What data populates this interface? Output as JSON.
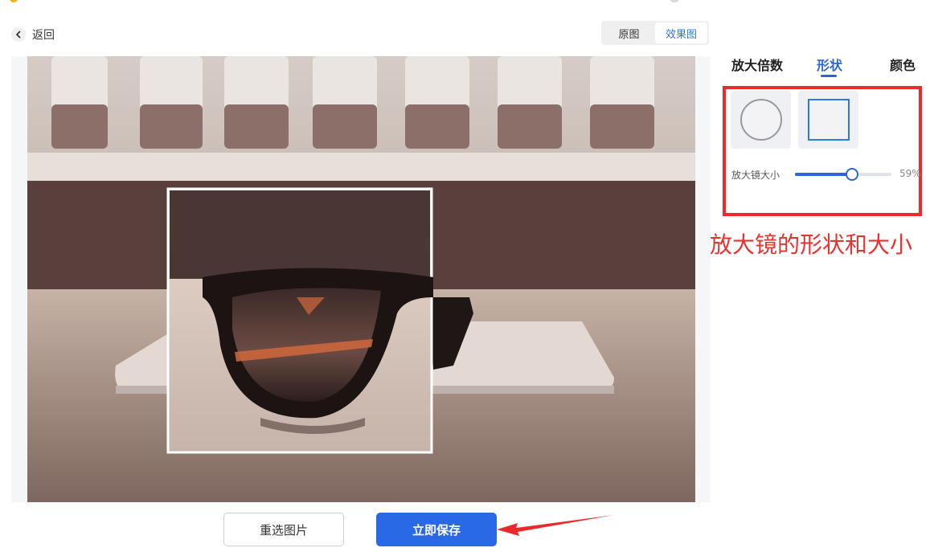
{
  "header": {
    "back_label": "返回",
    "view_toggle": {
      "original_label": "原图",
      "effect_label": "效果图",
      "active": "效果图"
    }
  },
  "panel": {
    "tabs": [
      {
        "label": "放大倍数",
        "active": false
      },
      {
        "label": "形状",
        "active": true
      },
      {
        "label": "颜色",
        "active": false
      }
    ],
    "shapes": [
      {
        "name": "circle",
        "selected": false
      },
      {
        "name": "square",
        "selected": true
      }
    ],
    "size_slider": {
      "label": "放大镜大小",
      "value_text": "59%",
      "value_percent": 59
    }
  },
  "annotation": {
    "text": "放大镜的形状和大小",
    "color": "#e8322f"
  },
  "footer": {
    "reselect_label": "重选图片",
    "save_label": "立即保存"
  },
  "colors": {
    "accent": "#2a66d8",
    "highlight": "#ee2b2b"
  },
  "icons": {
    "back": "chevron-left-icon",
    "arrow": "red-arrow-pointer-icon"
  }
}
